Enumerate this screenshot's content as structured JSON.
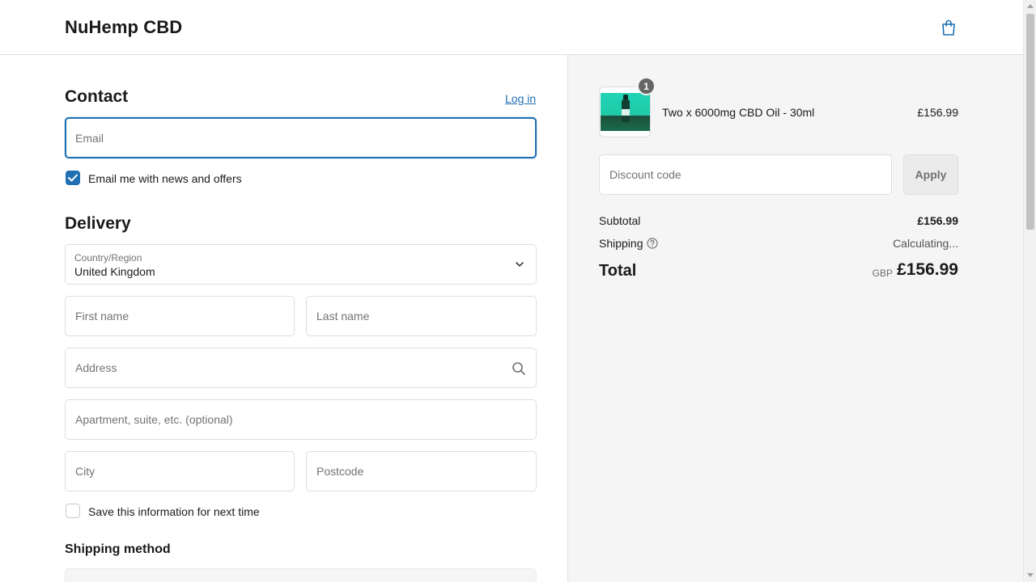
{
  "header": {
    "brand": "NuHemp CBD",
    "cart_icon": "shopping-bag-icon"
  },
  "contact": {
    "title": "Contact",
    "login_link": "Log in",
    "email_placeholder": "Email",
    "newsletter_label": "Email me with news and offers",
    "newsletter_checked": true
  },
  "delivery": {
    "title": "Delivery",
    "country_label": "Country/Region",
    "country_value": "United Kingdom",
    "first_name_placeholder": "First name",
    "last_name_placeholder": "Last name",
    "address_placeholder": "Address",
    "apartment_placeholder": "Apartment, suite, etc. (optional)",
    "city_placeholder": "City",
    "postcode_placeholder": "Postcode",
    "save_info_label": "Save this information for next time",
    "save_info_checked": false
  },
  "shipping_method": {
    "title": "Shipping method"
  },
  "order_summary": {
    "item": {
      "quantity": "1",
      "name": "Two x 6000mg CBD Oil - 30ml",
      "price": "£156.99"
    },
    "discount_placeholder": "Discount code",
    "apply_label": "Apply",
    "subtotal_label": "Subtotal",
    "subtotal_value": "£156.99",
    "shipping_label": "Shipping",
    "shipping_value": "Calculating...",
    "total_label": "Total",
    "total_currency": "GBP",
    "total_value": "£156.99"
  },
  "colors": {
    "accent": "#1f6fb2",
    "sidebar_bg": "#f5f5f5",
    "badge_bg": "#666666"
  }
}
